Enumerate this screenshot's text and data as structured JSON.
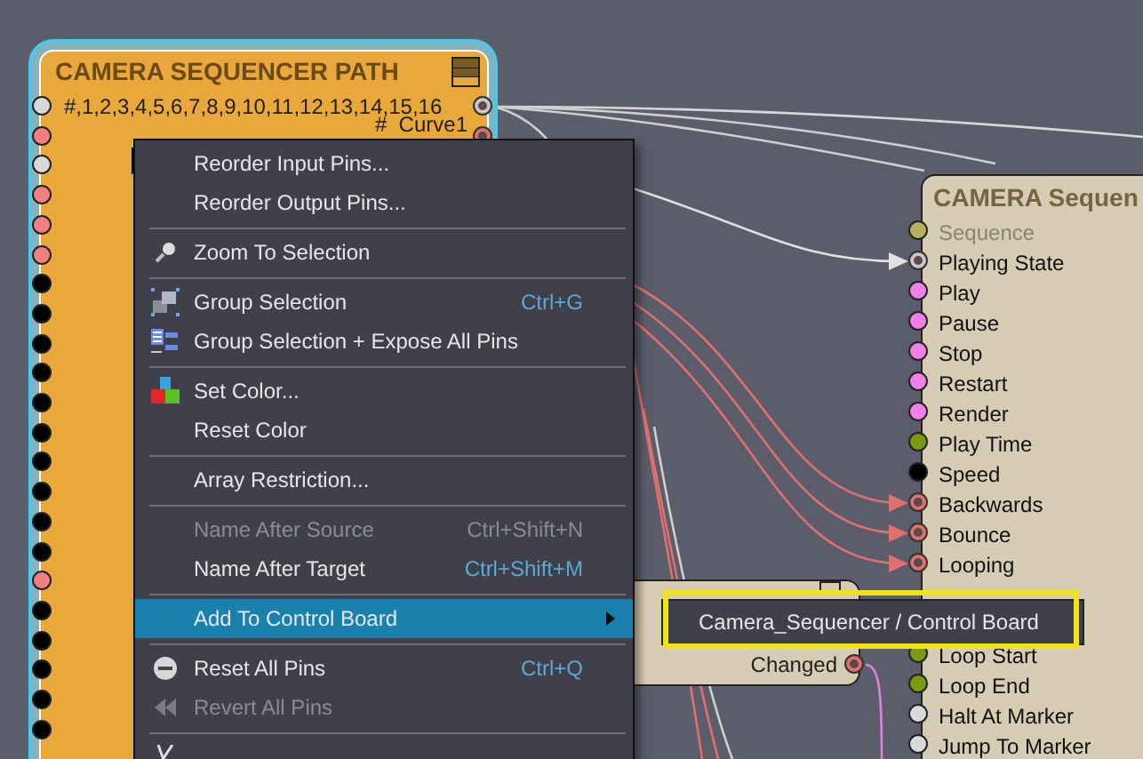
{
  "path_node": {
    "title": "CAMERA SEQUENCER PATH",
    "input_label": "#,1,2,3,4,5,6,7,8,9,10,11,12,13,14,15,16",
    "output_label": "#  Curve1",
    "output_pins": [
      {
        "color": "#c8c8c8"
      },
      {
        "color": "#e07070"
      }
    ],
    "input_pins": [
      {
        "color": "#d8d8d8"
      },
      {
        "color": "#f08080"
      },
      {
        "color": "#d8d8d8"
      },
      {
        "color": "#f08080"
      },
      {
        "color": "#f08080"
      },
      {
        "color": "#f08080"
      },
      {
        "color": "#000000"
      },
      {
        "color": "#000000"
      },
      {
        "color": "#000000"
      },
      {
        "color": "#000000"
      },
      {
        "color": "#000000"
      },
      {
        "color": "#000000"
      },
      {
        "color": "#000000"
      },
      {
        "color": "#000000"
      },
      {
        "color": "#000000"
      },
      {
        "color": "#000000"
      },
      {
        "color": "#f08080"
      },
      {
        "color": "#000000"
      },
      {
        "color": "#000000"
      },
      {
        "color": "#000000"
      },
      {
        "color": "#000000"
      },
      {
        "color": "#000000"
      }
    ]
  },
  "sequencer_node": {
    "title": "CAMERA Sequen",
    "pins": [
      {
        "label": "Sequence",
        "color": "#b8b060",
        "kind": "plain",
        "disabled": true
      },
      {
        "label": "Playing State",
        "color": "#c8c8c8",
        "kind": "ring",
        "disabled": false
      },
      {
        "label": "Play",
        "color": "#f080e8",
        "kind": "plain",
        "disabled": false
      },
      {
        "label": "Pause",
        "color": "#f080e8",
        "kind": "plain",
        "disabled": false
      },
      {
        "label": "Stop",
        "color": "#f080e8",
        "kind": "plain",
        "disabled": false
      },
      {
        "label": "Restart",
        "color": "#f080e8",
        "kind": "plain",
        "disabled": false
      },
      {
        "label": "Render",
        "color": "#f080e8",
        "kind": "plain",
        "disabled": false
      },
      {
        "label": "Play Time",
        "color": "#7a9a10",
        "kind": "plain",
        "disabled": false
      },
      {
        "label": "Speed",
        "color": "#000000",
        "kind": "plain",
        "disabled": false
      },
      {
        "label": "Backwards",
        "color": "#e07070",
        "kind": "ring",
        "disabled": false
      },
      {
        "label": "Bounce",
        "color": "#e07070",
        "kind": "ring",
        "disabled": false
      },
      {
        "label": "Looping",
        "color": "#e07070",
        "kind": "ring",
        "disabled": false
      },
      {
        "kind": "covered"
      },
      {
        "kind": "covered"
      },
      {
        "label": "Loop Start",
        "color": "#7a9a10",
        "kind": "plain",
        "disabled": false
      },
      {
        "label": "Loop End",
        "color": "#7a9a10",
        "kind": "plain",
        "disabled": false
      },
      {
        "label": "Halt At Marker",
        "color": "#d8d8d8",
        "kind": "plain",
        "disabled": false
      },
      {
        "label": "Jump To Marker",
        "color": "#d8d8d8",
        "kind": "plain",
        "disabled": false
      }
    ]
  },
  "changed_node": {
    "output_label": "Changed",
    "output_pins": [
      {
        "color": "#e07070"
      }
    ]
  },
  "context_menu": {
    "items": [
      {
        "kind": "plain",
        "label": "Reorder Input Pins...",
        "disabled": false,
        "selected": false,
        "submenu": false
      },
      {
        "kind": "plain",
        "label": "Reorder Output Pins...",
        "disabled": false,
        "selected": false,
        "submenu": false
      },
      {
        "kind": "separator"
      },
      {
        "kind": "zoom",
        "label": "Zoom To Selection",
        "disabled": false,
        "selected": false,
        "submenu": false
      },
      {
        "kind": "separator"
      },
      {
        "kind": "group",
        "label": "Group Selection",
        "shortcut": "Ctrl+G",
        "disabled": false,
        "selected": false,
        "submenu": false
      },
      {
        "kind": "expose",
        "label": "Group Selection + Expose All Pins",
        "disabled": false,
        "selected": false,
        "submenu": false
      },
      {
        "kind": "separator"
      },
      {
        "kind": "color",
        "label": "Set Color...",
        "disabled": false,
        "selected": false,
        "submenu": false
      },
      {
        "kind": "plain",
        "label": "Reset Color",
        "disabled": false,
        "selected": false,
        "submenu": false
      },
      {
        "kind": "separator"
      },
      {
        "kind": "plain",
        "label": "Array Restriction...",
        "disabled": false,
        "selected": false,
        "submenu": false
      },
      {
        "kind": "separator"
      },
      {
        "kind": "plain",
        "label": "Name After Source",
        "shortcut": "Ctrl+Shift+N",
        "disabled": true,
        "selected": false,
        "submenu": false
      },
      {
        "kind": "plain",
        "label": "Name After Target",
        "shortcut": "Ctrl+Shift+M",
        "disabled": false,
        "selected": false,
        "submenu": false
      },
      {
        "kind": "separator"
      },
      {
        "kind": "plain",
        "label": "Add To Control Board",
        "disabled": false,
        "selected": true,
        "submenu": true
      },
      {
        "kind": "separator"
      },
      {
        "kind": "reset",
        "label": "Reset All Pins",
        "shortcut": "Ctrl+Q",
        "disabled": false,
        "selected": false,
        "submenu": false
      },
      {
        "kind": "revert",
        "label": "Revert All Pins",
        "disabled": true,
        "selected": false,
        "submenu": false
      },
      {
        "kind": "separator"
      },
      {
        "kind": "cut"
      }
    ]
  },
  "submenu": {
    "items": [
      {
        "label": "Camera_Sequencer / Control Board",
        "highlighted": true
      }
    ]
  }
}
